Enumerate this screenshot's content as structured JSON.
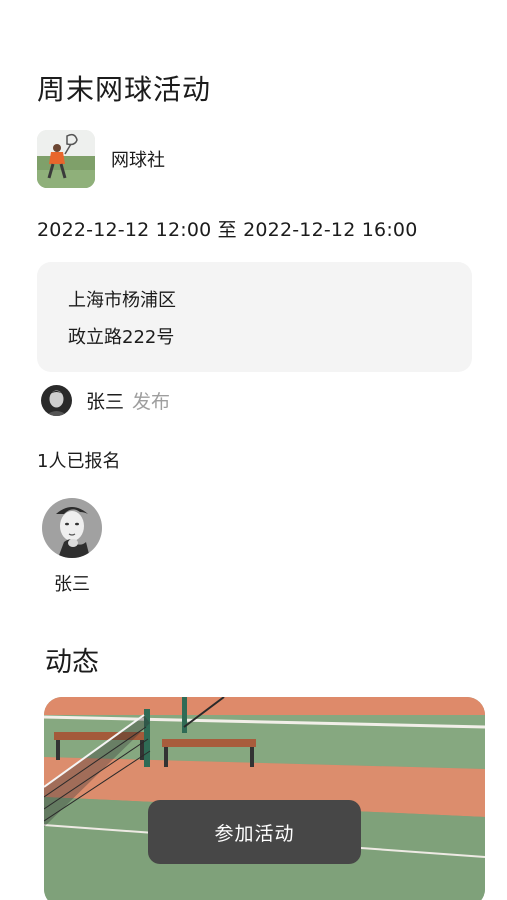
{
  "activity": {
    "title": "周末网球活动",
    "club_name": "网球社",
    "time_range": "2022-12-12 12:00 至 2022-12-12 16:00"
  },
  "address": {
    "line1": "上海市杨浦区",
    "line2": "政立路222号"
  },
  "publisher": {
    "name": "张三",
    "action": "发布"
  },
  "participants": {
    "count_text": "1人已报名",
    "members": [
      {
        "name": "张三"
      }
    ]
  },
  "moments": {
    "heading": "动态"
  },
  "actions": {
    "join_label": "参加活动"
  },
  "colors": {
    "card_bg": "#f4f4f4",
    "button_bg": "#474747",
    "muted_text": "#9e9e9e"
  }
}
